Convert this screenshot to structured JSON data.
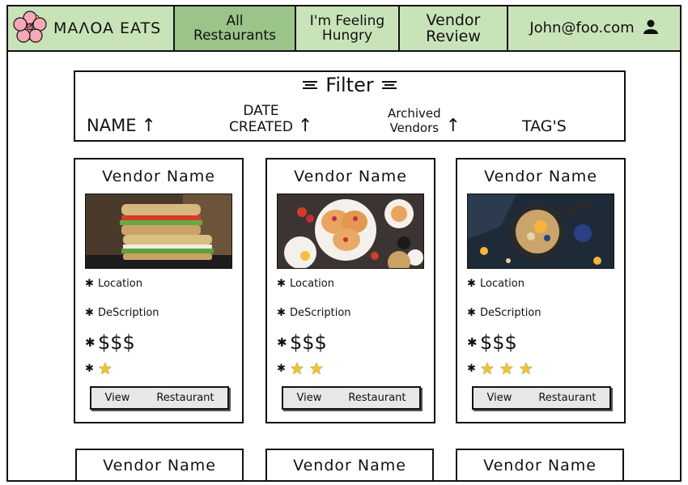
{
  "nav": {
    "brand": "MAΛOA EATS",
    "all_restaurants": "All\nRestaurants",
    "feeling_hungry": "I'm Feeling\nHungry",
    "vendor_review": "Vendor\nReview",
    "user_email": "John@foo.com",
    "icons": {
      "brand": "hibiscus-flower-icon",
      "user": "user-icon"
    }
  },
  "filter": {
    "title": "Filter",
    "columns": {
      "name": "NAME",
      "date_created": "DATE\nCREATED",
      "archived": "Archived\nVendors",
      "tags": "TAG'S"
    },
    "sort_arrow": "↑"
  },
  "cards": [
    {
      "title": "Vendor Name",
      "image": "sandwich-photo",
      "location": "Location",
      "description": "DeScription",
      "price": "$$$",
      "stars": 1,
      "view_label": "View",
      "restaurant_label": "Restaurant"
    },
    {
      "title": "Vendor Name",
      "image": "pancake-breakfast-photo",
      "location": "Location",
      "description": "DeScription",
      "price": "$$$",
      "stars": 2,
      "view_label": "View",
      "restaurant_label": "Restaurant"
    },
    {
      "title": "Vendor Name",
      "image": "skillet-oatmeal-photo",
      "location": "Location",
      "description": "DeScription",
      "price": "$$$",
      "stars": 3,
      "view_label": "View",
      "restaurant_label": "Restaurant"
    }
  ],
  "cards_row2": [
    {
      "title": "Vendor Name"
    },
    {
      "title": "Vendor Name"
    },
    {
      "title": "Vendor Name"
    }
  ],
  "colors": {
    "nav_bg": "#c9e3b8",
    "nav_active": "#9bc489",
    "star": "#f3c623"
  }
}
